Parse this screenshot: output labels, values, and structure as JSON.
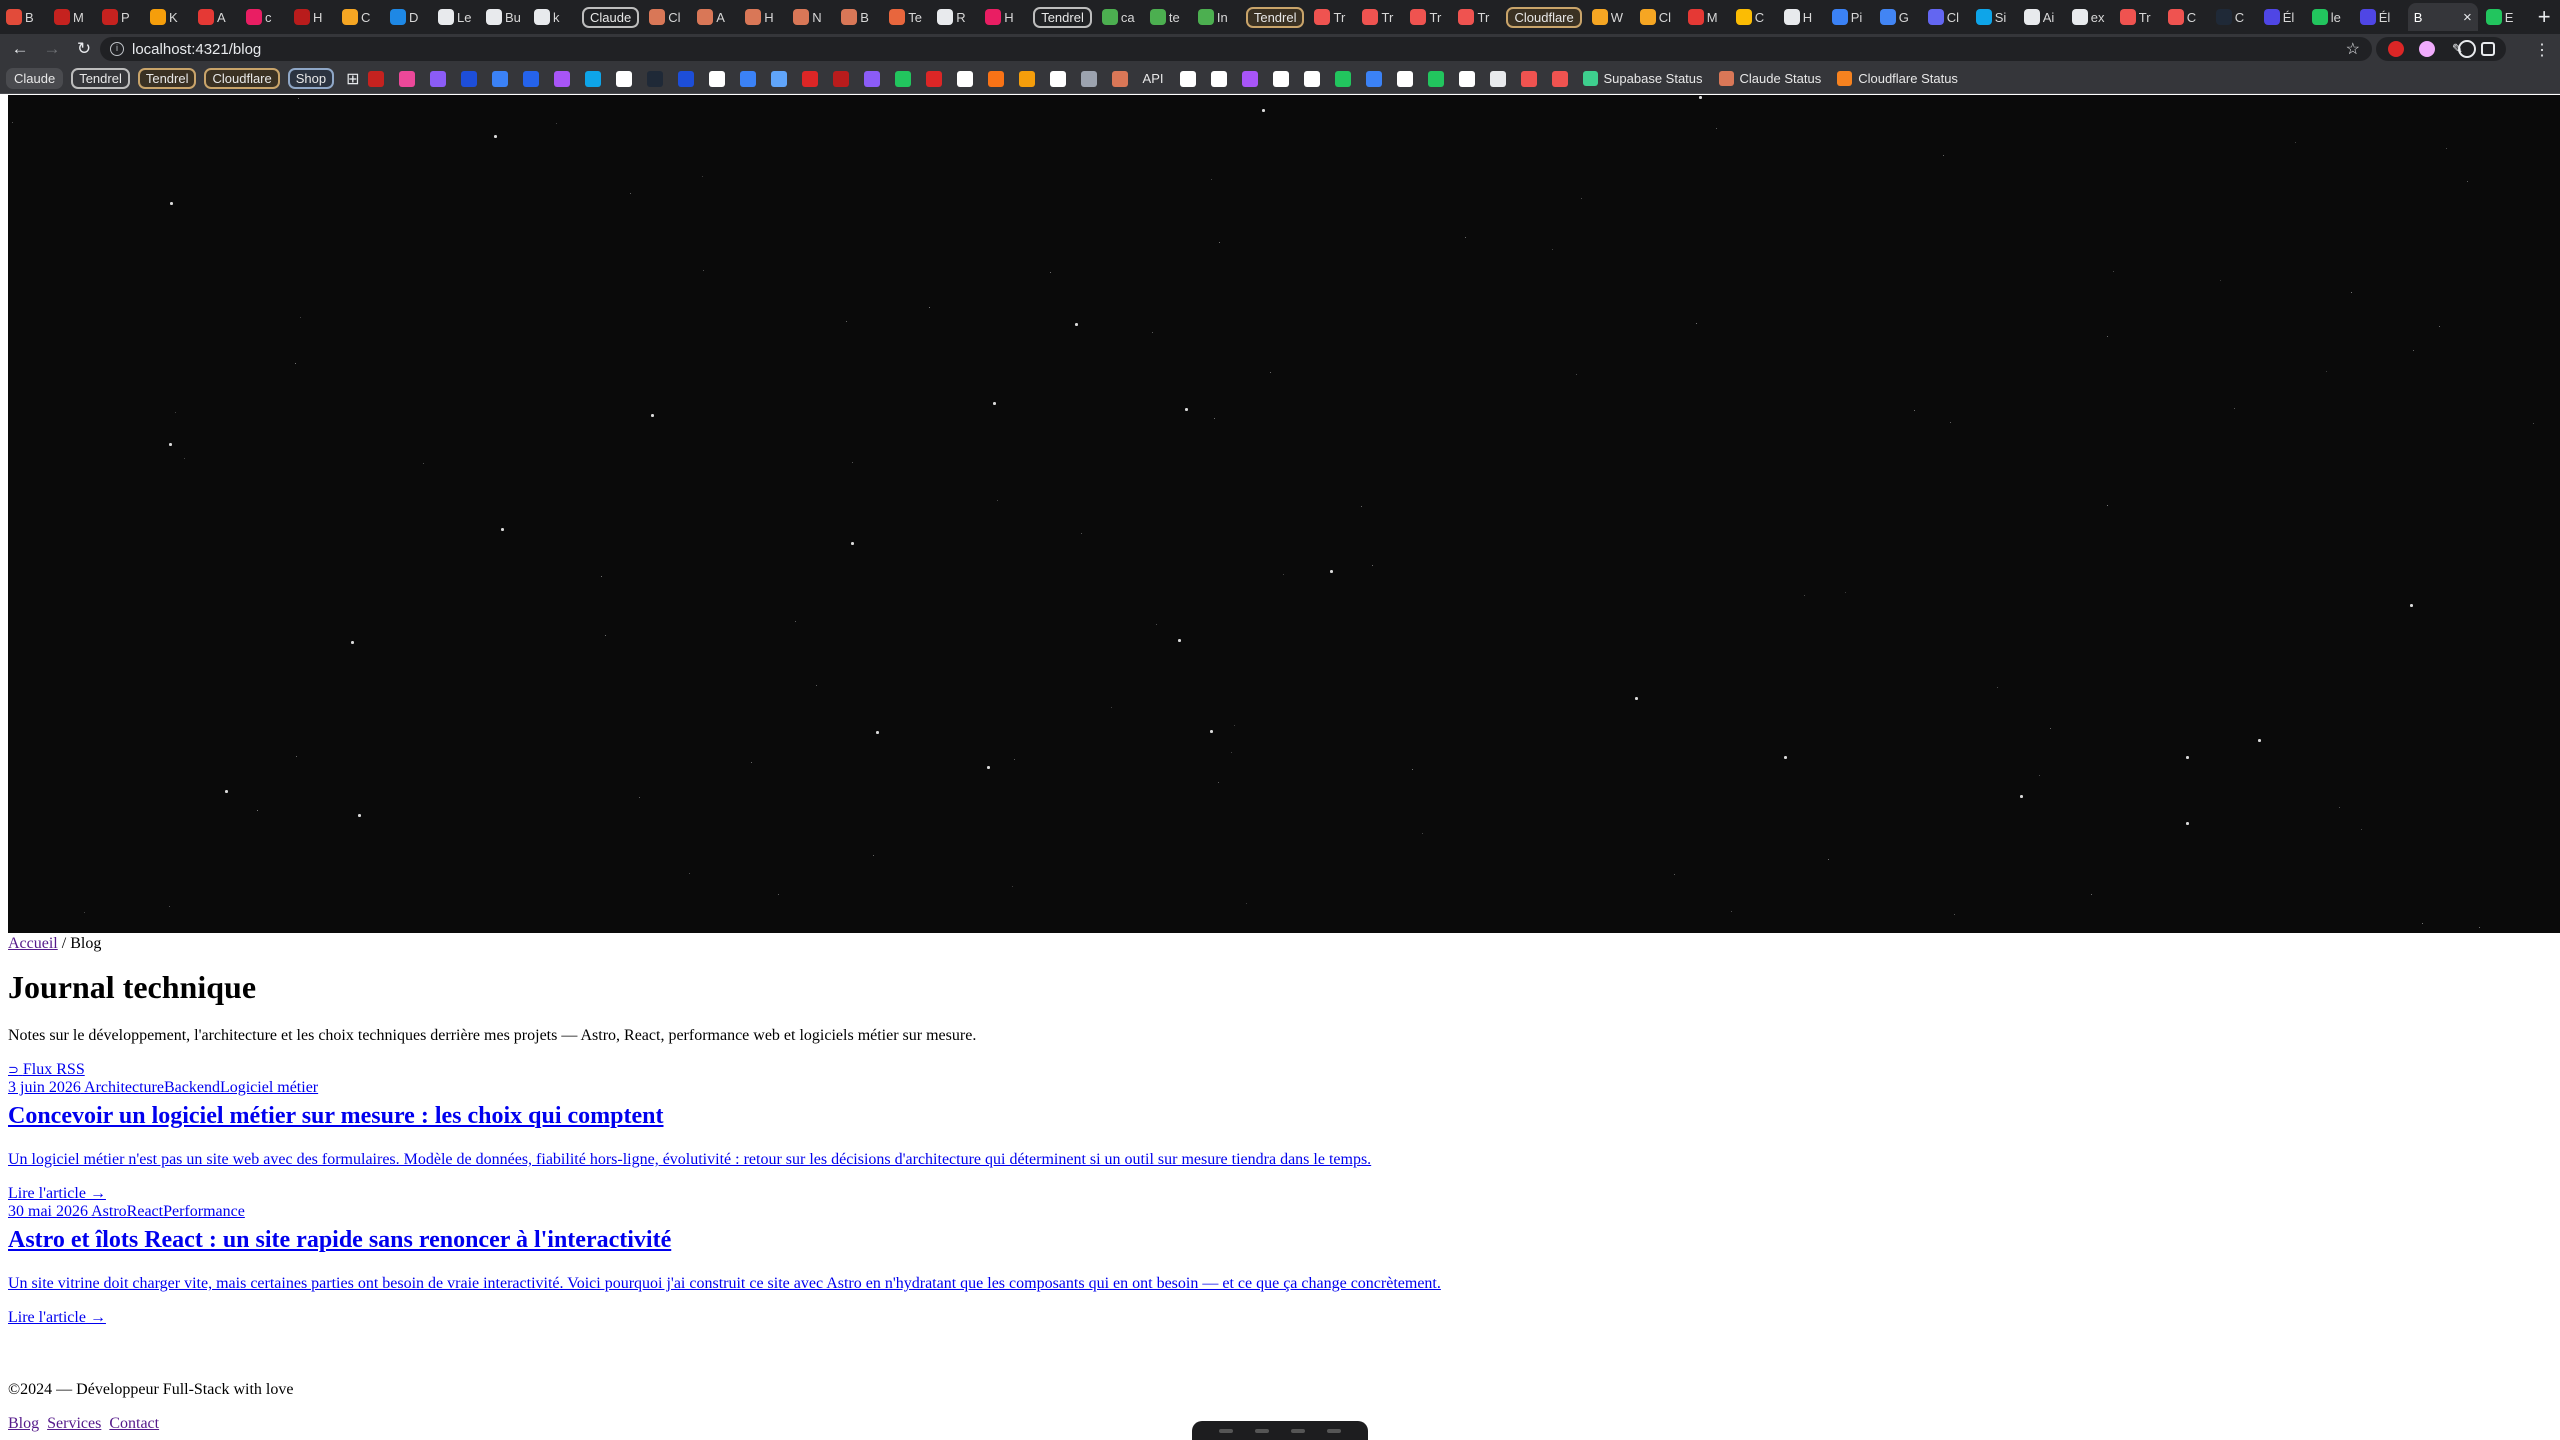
{
  "browser": {
    "tabs": [
      {
        "label": "B",
        "color": "#e24b3a"
      },
      {
        "label": "M",
        "color": "#c5221f"
      },
      {
        "label": "P",
        "color": "#c5221f"
      },
      {
        "label": "K",
        "color": "#f59e0b"
      },
      {
        "label": "A",
        "color": "#e53935"
      },
      {
        "label": "c",
        "color": "#e91e63"
      },
      {
        "label": "H",
        "color": "#b91c1c"
      },
      {
        "label": "C",
        "color": "#f6a623"
      },
      {
        "label": "D",
        "color": "#1e88e5"
      },
      {
        "label": "Le",
        "color": "#e8eaed"
      },
      {
        "label": "Bu",
        "color": "#e8eaed"
      },
      {
        "label": "k",
        "color": "#e8eaed"
      }
    ],
    "tab_groups": [
      "Claude",
      "Tendrel",
      "Tendrel",
      "Cloudflare"
    ],
    "more_tabs": [
      {
        "label": "Cl",
        "color": "#d97757"
      },
      {
        "label": "A",
        "color": "#d97757"
      },
      {
        "label": "H",
        "color": "#d97757"
      },
      {
        "label": "N",
        "color": "#d97757"
      },
      {
        "label": "B",
        "color": "#d97757"
      },
      {
        "label": "Te",
        "color": "#e8663d"
      },
      {
        "label": "R",
        "color": "#e8eaed"
      },
      {
        "label": "H",
        "color": "#e91e63"
      },
      {
        "label": "ca",
        "color": "#4caf50"
      },
      {
        "label": "te",
        "color": "#4caf50"
      },
      {
        "label": "In",
        "color": "#4caf50"
      },
      {
        "label": "Tr",
        "color": "#ef5350"
      },
      {
        "label": "Tr",
        "color": "#ef5350"
      },
      {
        "label": "Tr",
        "color": "#ef5350"
      },
      {
        "label": "Tr",
        "color": "#ef5350"
      },
      {
        "label": "W",
        "color": "#f6a623"
      },
      {
        "label": "Cl",
        "color": "#f6a623"
      },
      {
        "label": "M",
        "color": "#e53935"
      },
      {
        "label": "C",
        "color": "#fbbc04"
      },
      {
        "label": "H",
        "color": "#e8eaed"
      },
      {
        "label": "Pi",
        "color": "#3b82f6"
      },
      {
        "label": "G",
        "color": "#4285f4"
      },
      {
        "label": "Cl",
        "color": "#6366f1"
      },
      {
        "label": "Si",
        "color": "#0ea5e9"
      },
      {
        "label": "Ai",
        "color": "#e8eaed"
      },
      {
        "label": "ex",
        "color": "#e8eaed"
      },
      {
        "label": "Tr",
        "color": "#ef5350"
      },
      {
        "label": "C",
        "color": "#ef5350"
      },
      {
        "label": "C",
        "color": "#1f2937"
      },
      {
        "label": "Él",
        "color": "#4f46e5"
      },
      {
        "label": "le",
        "color": "#22c55e"
      },
      {
        "label": "Él",
        "color": "#4f46e5"
      }
    ],
    "active_tab": {
      "label": "B",
      "close": "×"
    },
    "last_tab": {
      "label": "E",
      "color": "#22c55e"
    },
    "new_tab_label": "+",
    "url": "localhost:4321/blog",
    "bookmarks_pills": [
      "Claude",
      "Tendrel",
      "Tendrel",
      "Cloudflare",
      "Shop"
    ],
    "bookmark_icon_colors": [
      "#c5221f",
      "#ec4899",
      "#8b5cf6",
      "#1d4ed8",
      "#3b82f6",
      "#2563eb",
      "#a855f7",
      "#0ea5e9",
      "#ffffff",
      "#1f2937",
      "#1d4ed8",
      "#ffffff",
      "#3b82f6",
      "#60a5fa",
      "#dc2626",
      "#b91c1c",
      "#8b5cf6",
      "#22c55e",
      "#dc2626",
      "#ffffff",
      "#f97316",
      "#f59e0b",
      "#ffffff",
      "#9ca3af",
      "#d97757"
    ],
    "bookmark_api_label": "API",
    "bookmark_icon_colors_2": [
      "#ffffff",
      "#ffffff",
      "#a855f7",
      "#ffffff",
      "#ffffff",
      "#22c55e",
      "#3b82f6",
      "#ffffff",
      "#22c55e",
      "#ffffff",
      "#e8eaed",
      "#ef5350",
      "#ef5350"
    ],
    "bookmark_links": [
      {
        "label": "Supabase Status",
        "color": "#3ecf8e"
      },
      {
        "label": "Claude Status",
        "color": "#d97757"
      },
      {
        "label": "Cloudflare Status",
        "color": "#f6821f"
      }
    ]
  },
  "page": {
    "breadcrumb": {
      "home": "Accueil",
      "separator": " / ",
      "current": "Blog"
    },
    "title": "Journal technique",
    "description": "Notes sur le développement, l'architecture et les choix techniques derrière mes projets — Astro, React, performance web et logiciels métier sur mesure.",
    "rss": "Flux RSS",
    "posts": [
      {
        "date": "3 juin 2026",
        "tags": "ArchitectureBackendLogiciel métier",
        "title": "Concevoir un logiciel métier sur mesure : les choix qui comptent",
        "excerpt": "Un logiciel métier n'est pas un site web avec des formulaires. Modèle de données, fiabilité hors-ligne, évolutivité : retour sur les décisions d'architecture qui déterminent si un outil sur mesure tiendra dans le temps.",
        "link": "Lire l'article →"
      },
      {
        "date": "30 mai 2026",
        "tags": "AstroReactPerformance",
        "title": "Astro et îlots React : un site rapide sans renoncer à l'interactivité",
        "excerpt": "Un site vitrine doit charger vite, mais certaines parties ont besoin de vraie interactivité. Voici pourquoi j'ai construit ce site avec Astro en n'hydratant que les composants qui en ont besoin — et ce que ça change concrètement.",
        "link": "Lire l'article →"
      }
    ],
    "footer": {
      "copyright": "©2024 — Développeur Full-Stack with love",
      "links": [
        "Blog",
        "Services",
        "Contact"
      ]
    }
  }
}
